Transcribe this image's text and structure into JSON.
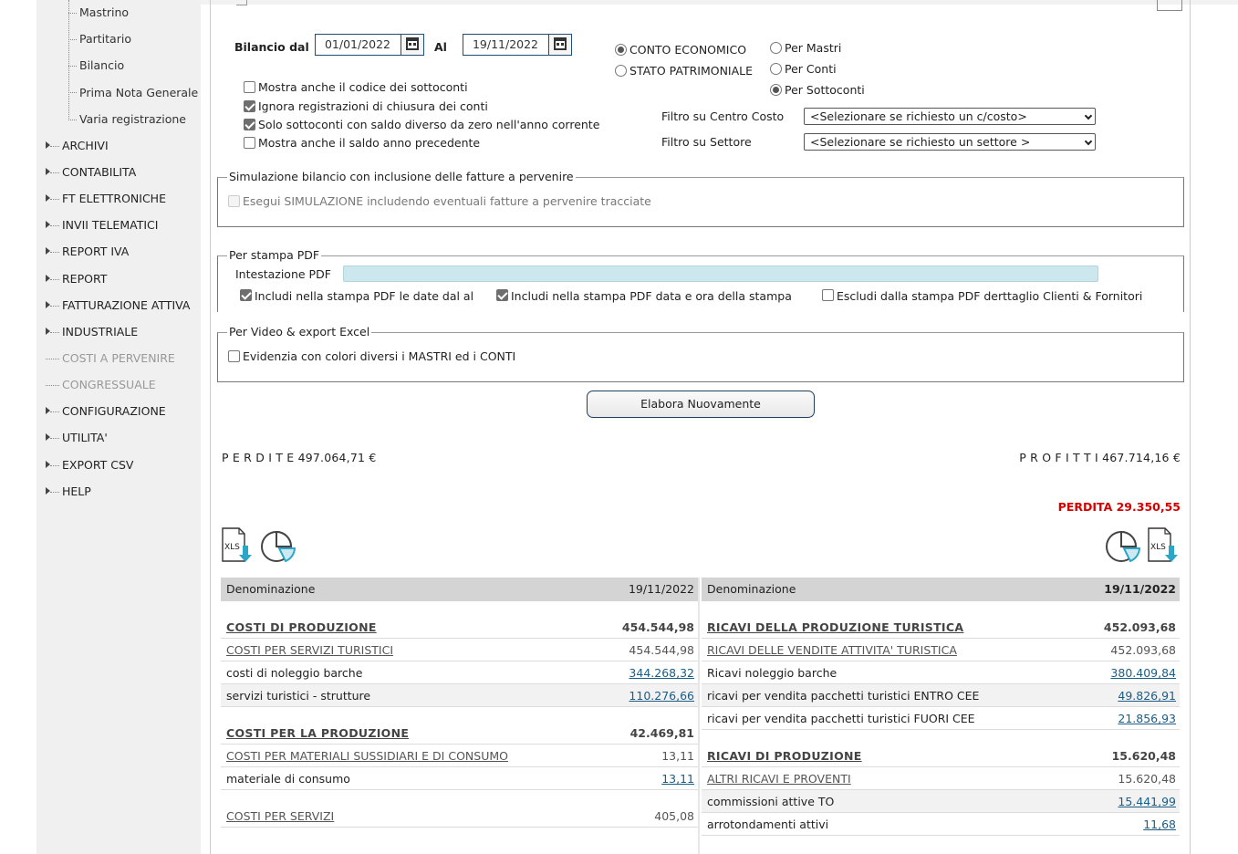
{
  "sidebar": {
    "submenu": [
      "Mastrino",
      "Partitario",
      "Bilancio",
      "Prima Nota Generale",
      "Varia registrazione"
    ],
    "menu": [
      {
        "label": "ARCHIVI",
        "enabled": true
      },
      {
        "label": "CONTABILITA",
        "enabled": true
      },
      {
        "label": "FT ELETTRONICHE",
        "enabled": true
      },
      {
        "label": "INVII TELEMATICI",
        "enabled": true
      },
      {
        "label": "REPORT IVA",
        "enabled": true
      },
      {
        "label": "REPORT",
        "enabled": true
      },
      {
        "label": "FATTURAZIONE ATTIVA",
        "enabled": true
      },
      {
        "label": "INDUSTRIALE",
        "enabled": true
      },
      {
        "label": "COSTI A PERVENIRE",
        "enabled": false
      },
      {
        "label": "CONGRESSUALE",
        "enabled": false
      },
      {
        "label": "CONFIGURAZIONE",
        "enabled": true
      },
      {
        "label": "UTILITA'",
        "enabled": true
      },
      {
        "label": "EXPORT CSV",
        "enabled": true
      },
      {
        "label": "HELP",
        "enabled": true
      }
    ]
  },
  "filters": {
    "bilancio_dal_label": "Bilancio dal",
    "date_from": "01/01/2022",
    "al_label": "Al",
    "date_to": "19/11/2022",
    "report_type": {
      "options": [
        "CONTO ECONOMICO",
        "STATO PATRIMONIALE"
      ],
      "selected": 0
    },
    "detail_level": {
      "options": [
        "Per Mastri",
        "Per Conti",
        "Per Sottoconti"
      ],
      "selected": 2
    },
    "checkboxes": [
      {
        "label": "Mostra anche il codice dei sottoconti",
        "checked": false
      },
      {
        "label": "Ignora registrazioni di chiusura dei conti",
        "checked": true
      },
      {
        "label": "Solo sottoconti con saldo diverso da zero nell'anno corrente",
        "checked": true
      },
      {
        "label": "Mostra anche il saldo anno precedente",
        "checked": false
      }
    ],
    "centro_costo_label": "Filtro su Centro Costo",
    "centro_costo_value": "<Selezionare se richiesto un c/costo>",
    "settore_label": "Filtro su Settore",
    "settore_value": "<Selezionare se richiesto un settore >"
  },
  "simulazione": {
    "legend": "Simulazione bilancio con inclusione delle fatture a pervenire",
    "checkbox": "Esegui SIMULAZIONE includendo eventuali fatture a pervenire tracciate"
  },
  "pdf": {
    "legend": "Per stampa PDF",
    "intestazione_label": "Intestazione PDF",
    "opt1": "Includi nella stampa PDF le date dal al",
    "opt2": "Includi nella stampa PDF data e ora della stampa",
    "opt3": "Escludi dalla stampa PDF derttaglio Clienti & Fornitori"
  },
  "video": {
    "legend": "Per Video & export Excel",
    "checkbox": "Evidenzia con colori diversi i MASTRI ed i CONTI"
  },
  "actions": {
    "elabora": "Elabora Nuovamente"
  },
  "totals": {
    "perdite": "P E R D I T E 497.064,71 €",
    "profitti": "P R O F I T T I 467.714,16 €",
    "risultato": "PERDITA 29.350,55"
  },
  "icons": {
    "xls": "XLS",
    "accent": "#2aa6c8",
    "negative": "#d50000",
    "link": "#1a5d86"
  },
  "table_left": {
    "header": [
      "Denominazione",
      "19/11/2022"
    ],
    "rows": [
      {
        "type": "group",
        "name": "COSTI DI PRODUZIONE",
        "value": "454.544,98"
      },
      {
        "type": "sub",
        "name": "COSTI PER SERVIZI TURISTICI",
        "value": "454.544,98"
      },
      {
        "type": "item",
        "name": "costi di noleggio barche",
        "value": "344.268,32"
      },
      {
        "type": "item",
        "name": "servizi turistici - strutture",
        "value": "110.276,66"
      },
      {
        "type": "group",
        "name": "COSTI PER LA PRODUZIONE",
        "value": "42.469,81"
      },
      {
        "type": "sub",
        "name": "COSTI PER MATERIALI SUSSIDIARI E DI CONSUMO",
        "value": "13,11"
      },
      {
        "type": "item",
        "name": "materiale di consumo",
        "value": "13,11"
      },
      {
        "type": "sub",
        "name": "COSTI PER SERVIZI",
        "value": "405,08"
      }
    ]
  },
  "table_right": {
    "header": [
      "Denominazione",
      "19/11/2022"
    ],
    "rows": [
      {
        "type": "group",
        "name": "RICAVI DELLA PRODUZIONE TURISTICA",
        "value": "452.093,68"
      },
      {
        "type": "sub",
        "name": "RICAVI DELLE VENDITE ATTIVITA' TURISTICA",
        "value": "452.093,68"
      },
      {
        "type": "item",
        "name": "Ricavi noleggio barche",
        "value": "380.409,84"
      },
      {
        "type": "item",
        "name": "ricavi per vendita pacchetti turistici ENTRO CEE",
        "value": "49.826,91"
      },
      {
        "type": "item",
        "name": "ricavi per vendita pacchetti turistici FUORI CEE",
        "value": "21.856,93"
      },
      {
        "type": "group",
        "name": "RICAVI DI PRODUZIONE",
        "value": "15.620,48"
      },
      {
        "type": "sub",
        "name": "ALTRI RICAVI E PROVENTI",
        "value": "15.620,48"
      },
      {
        "type": "item",
        "name": "commissioni attive TO",
        "value": "15.441,99"
      },
      {
        "type": "item",
        "name": "arrotondamenti attivi",
        "value": "11,68"
      }
    ]
  }
}
